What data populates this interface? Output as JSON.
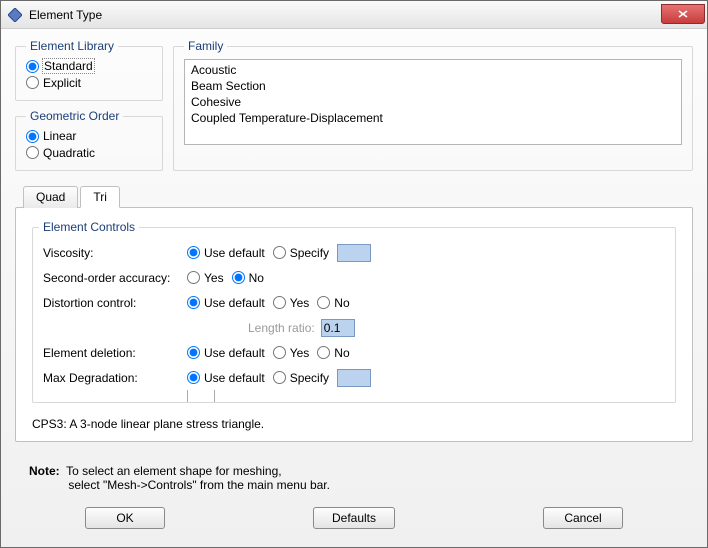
{
  "window": {
    "title": "Element Type"
  },
  "elementLibrary": {
    "legend": "Element Library",
    "options": {
      "standard": "Standard",
      "explicit": "Explicit"
    },
    "selected": "standard"
  },
  "geometricOrder": {
    "legend": "Geometric Order",
    "options": {
      "linear": "Linear",
      "quadratic": "Quadratic"
    },
    "selected": "linear"
  },
  "family": {
    "legend": "Family",
    "items": [
      "Acoustic",
      "Beam Section",
      "Cohesive",
      "Coupled Temperature-Displacement"
    ]
  },
  "tabs": {
    "quad": "Quad",
    "tri": "Tri",
    "active": "tri"
  },
  "elementControls": {
    "legend": "Element Controls",
    "viscosity": {
      "label": "Viscosity:",
      "opts": {
        "useDefault": "Use default",
        "specify": "Specify"
      },
      "selected": "useDefault",
      "value": ""
    },
    "secondOrder": {
      "label": "Second-order accuracy:",
      "opts": {
        "yes": "Yes",
        "no": "No"
      },
      "selected": "no"
    },
    "distortion": {
      "label": "Distortion control:",
      "opts": {
        "useDefault": "Use default",
        "yes": "Yes",
        "no": "No"
      },
      "selected": "useDefault"
    },
    "lengthRatio": {
      "label": "Length ratio:",
      "value": "0.1"
    },
    "elementDeletion": {
      "label": "Element deletion:",
      "opts": {
        "useDefault": "Use default",
        "yes": "Yes",
        "no": "No"
      },
      "selected": "useDefault"
    },
    "maxDegradation": {
      "label": "Max Degradation:",
      "opts": {
        "useDefault": "Use default",
        "specify": "Specify"
      },
      "selected": "useDefault",
      "value": ""
    }
  },
  "description": "CPS3:  A 3-node linear plane stress triangle.",
  "note": {
    "label": "Note:",
    "line1": "To select an element shape for meshing,",
    "line2": "select \"Mesh->Controls\" from the main menu bar."
  },
  "buttons": {
    "ok": "OK",
    "defaults": "Defaults",
    "cancel": "Cancel"
  }
}
